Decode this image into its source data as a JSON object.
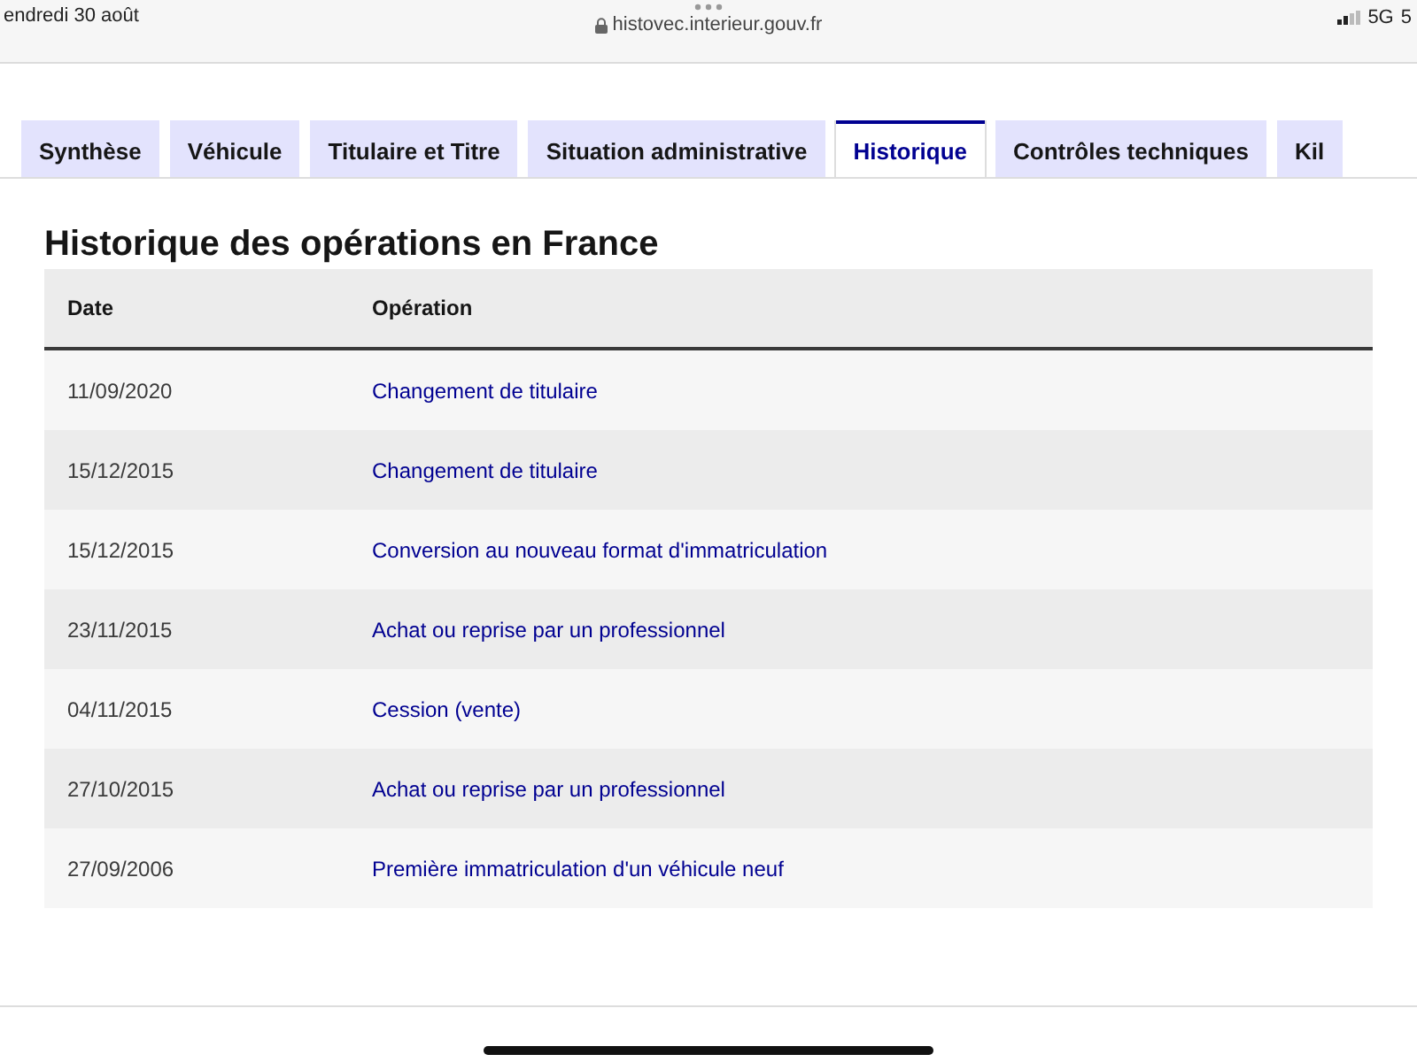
{
  "status_bar": {
    "date": "endredi 30 août",
    "url": "histovec.interieur.gouv.fr",
    "network": "5G",
    "battery": "5"
  },
  "tabs": [
    {
      "label": "Synthèse",
      "selected": false
    },
    {
      "label": "Véhicule",
      "selected": false
    },
    {
      "label": "Titulaire et Titre",
      "selected": false
    },
    {
      "label": "Situation administrative",
      "selected": false
    },
    {
      "label": "Historique",
      "selected": true
    },
    {
      "label": "Contrôles techniques",
      "selected": false
    },
    {
      "label": "Kil",
      "selected": false
    }
  ],
  "section_title": "Historique des opérations en France",
  "table": {
    "columns": [
      "Date",
      "Opération"
    ],
    "rows": [
      {
        "date": "11/09/2020",
        "operation": "Changement de titulaire"
      },
      {
        "date": "15/12/2015",
        "operation": "Changement de titulaire"
      },
      {
        "date": "15/12/2015",
        "operation": "Conversion au nouveau format d'immatriculation"
      },
      {
        "date": "23/11/2015",
        "operation": "Achat ou reprise par un professionnel"
      },
      {
        "date": "04/11/2015",
        "operation": "Cession (vente)"
      },
      {
        "date": "27/10/2015",
        "operation": "Achat ou reprise par un professionnel"
      },
      {
        "date": "27/09/2006",
        "operation": "Première immatriculation d'un véhicule neuf"
      }
    ]
  }
}
